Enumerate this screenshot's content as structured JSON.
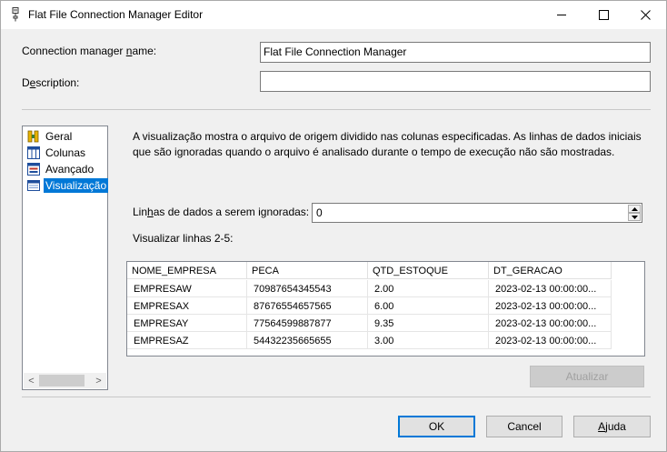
{
  "window": {
    "title": "Flat File Connection Manager Editor"
  },
  "form": {
    "name_label_pre": "Connection manager ",
    "name_label_ul": "n",
    "name_label_post": "ame:",
    "name_value": "Flat File Connection Manager",
    "desc_label_pre": "D",
    "desc_label_ul": "e",
    "desc_label_post": "scription:",
    "desc_value": ""
  },
  "nav": {
    "items": [
      {
        "label": "Geral",
        "icon": "general-icon"
      },
      {
        "label": "Colunas",
        "icon": "columns-icon"
      },
      {
        "label": "Avançado",
        "icon": "advanced-icon"
      },
      {
        "label": "Visualização",
        "icon": "preview-icon",
        "selected": true
      }
    ],
    "scroll_left": "<",
    "scroll_right": ">"
  },
  "preview": {
    "description": "A visualização mostra o arquivo de origem dividido nas colunas especificadas. As linhas de dados iniciais que são ignoradas quando o arquivo é analisado durante o tempo de execução não são mostradas.",
    "skip_label_pre": "Lin",
    "skip_label_ul": "h",
    "skip_label_post": "as de dados a serem ignoradas:",
    "skip_value": "0",
    "rows_label": "Visualizar linhas 2-5:",
    "columns": [
      "NOME_EMPRESA",
      "PECA",
      "QTD_ESTOQUE",
      "DT_GERACAO"
    ],
    "rows": [
      [
        "EMPRESAW",
        "70987654345543",
        "2.00",
        "2023-02-13 00:00:00..."
      ],
      [
        "EMPRESAX",
        "87676554657565",
        "6.00",
        "2023-02-13 00:00:00..."
      ],
      [
        "EMPRESAY",
        "77564599887877",
        "9.35",
        "2023-02-13 00:00:00..."
      ],
      [
        "EMPRESAZ",
        "54432235665655",
        "3.00",
        "2023-02-13 00:00:00..."
      ]
    ],
    "refresh_label": "Atualizar"
  },
  "buttons": {
    "ok": "OK",
    "cancel": "Cancel",
    "help_ul": "A",
    "help_post": "juda"
  }
}
